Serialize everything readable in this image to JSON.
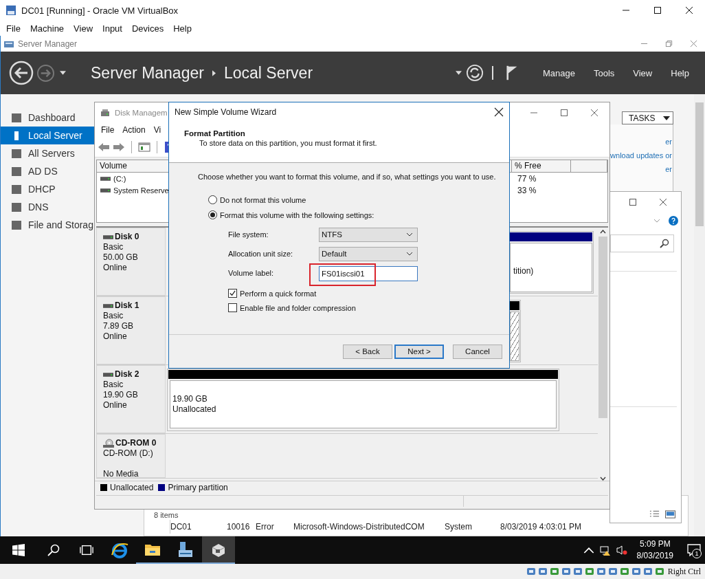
{
  "vbox": {
    "title": "DC01 [Running] - Oracle VM VirtualBox",
    "menu": [
      "File",
      "Machine",
      "View",
      "Input",
      "Devices",
      "Help"
    ],
    "host_key": "Right Ctrl"
  },
  "server_manager": {
    "title": "Server Manager",
    "breadcrumb": [
      "Server Manager",
      "Local Server"
    ],
    "menu": [
      "Manage",
      "Tools",
      "View",
      "Help"
    ],
    "sidebar": [
      {
        "label": "Dashboard",
        "selected": false
      },
      {
        "label": "Local Server",
        "selected": true
      },
      {
        "label": "All Servers",
        "selected": false
      },
      {
        "label": "AD DS",
        "selected": false
      },
      {
        "label": "DHCP",
        "selected": false
      },
      {
        "label": "DNS",
        "selected": false
      },
      {
        "label": "File and Storag",
        "selected": false
      }
    ],
    "tasks": "TASKS",
    "links": [
      "er",
      "wnload updates or",
      "er"
    ],
    "events": {
      "count": "8 items",
      "row": [
        "DC01",
        "10016",
        "Error",
        "Microsoft-Windows-DistributedCOM",
        "System",
        "8/03/2019 4:03:01 PM"
      ]
    }
  },
  "disk_management": {
    "title": "Disk Managem",
    "menu": [
      "File",
      "Action",
      "Vi"
    ],
    "columns": [
      "Volume",
      "% Free"
    ],
    "volumes": [
      {
        "name": "(C:)",
        "free": "77 %"
      },
      {
        "name": "System Reserve",
        "free": "33 %"
      }
    ],
    "disks": [
      {
        "kind": "disk",
        "name": "Disk 0",
        "lines": [
          "Basic",
          "50.00 GB",
          "Online"
        ],
        "partition": {
          "kind": "primary",
          "lines": [
            "tition)"
          ]
        }
      },
      {
        "kind": "disk",
        "name": "Disk 1",
        "lines": [
          "Basic",
          "7.89 GB",
          "Online"
        ],
        "partition": {
          "kind": "selected"
        }
      },
      {
        "kind": "disk",
        "name": "Disk 2",
        "lines": [
          "Basic",
          "19.90 GB",
          "Online"
        ],
        "partition": {
          "kind": "unallocated",
          "lines": [
            "19.90 GB",
            "Unallocated"
          ]
        }
      },
      {
        "kind": "cdrom",
        "name": "CD-ROM 0",
        "lines": [
          "CD-ROM (D:)",
          "No Media"
        ]
      }
    ],
    "legend": [
      {
        "label": "Unallocated",
        "color": "#000000"
      },
      {
        "label": "Primary partition",
        "color": "#000080"
      }
    ]
  },
  "wizard": {
    "title": "New Simple Volume Wizard",
    "heading": "Format Partition",
    "subheading": "To store data on this partition, you must format it first.",
    "prompt": "Choose whether you want to format this volume, and if so, what settings you want to use.",
    "options": [
      {
        "label": "Do not format this volume",
        "selected": false
      },
      {
        "label": "Format this volume with the following settings:",
        "selected": true
      }
    ],
    "fields": [
      {
        "kind": "dropdown",
        "label": "File system:",
        "value": "NTFS",
        "highlighted": false
      },
      {
        "kind": "dropdown",
        "label": "Allocation unit size:",
        "value": "Default",
        "highlighted": false
      },
      {
        "kind": "text",
        "label": "Volume label:",
        "value": "FS01iscsi01",
        "highlighted": true
      }
    ],
    "checkboxes": [
      {
        "label": "Perform a quick format",
        "checked": true
      },
      {
        "label": "Enable file and folder compression",
        "checked": false
      }
    ],
    "buttons": [
      {
        "label": "< Back",
        "default": false
      },
      {
        "label": "Next >",
        "default": true
      },
      {
        "label": "Cancel",
        "default": false
      }
    ]
  },
  "taskbar": {
    "apps": [
      {
        "kind": "browser",
        "selected": false,
        "running": false
      },
      {
        "kind": "folder",
        "selected": false,
        "running": true
      },
      {
        "kind": "server",
        "selected": false,
        "running": true
      },
      {
        "kind": "vm",
        "selected": true,
        "running": true
      }
    ],
    "time": "5:09 PM",
    "date": "8/03/2019",
    "notifications": "1"
  }
}
